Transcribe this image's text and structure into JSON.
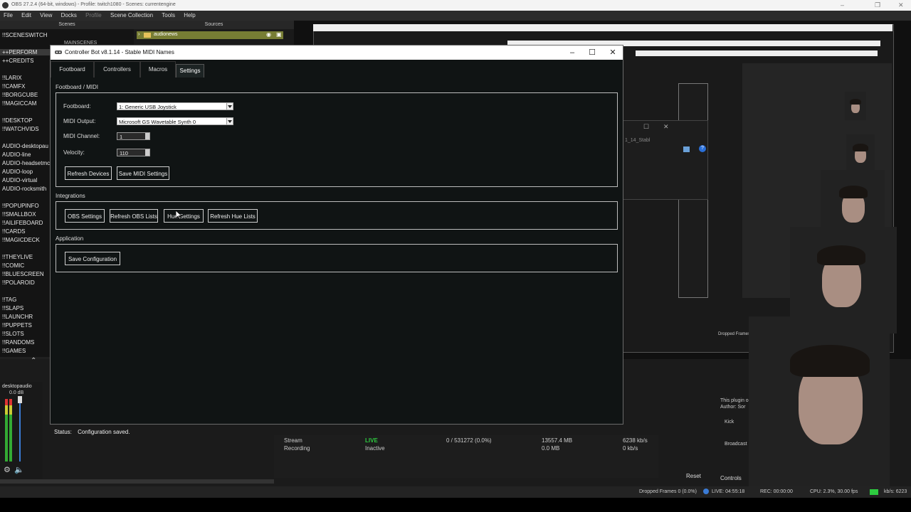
{
  "obs": {
    "title": "OBS 27.2.4 (64-bit, windows) - Profile: twitch1080 - Scenes: currentengine",
    "menu": [
      "File",
      "Edit",
      "View",
      "Docks",
      "Profile",
      "Scene Collection",
      "Tools",
      "Help"
    ],
    "scenes_header": "Scenes",
    "sources_header": "Sources",
    "scenes": [
      "!!SCENESWITCH",
      "++PERFORM",
      "++CREDITS",
      "!!LARIX",
      "!!CAMFX",
      "!!BORGCUBE",
      "!!MAGICCAM",
      "!!DESKTOP",
      "!!WATCHVIDS",
      "AUDIO-desktopau",
      "AUDIO-line",
      "AUDIO-headsetmc",
      "AUDIO-loop",
      "AUDIO-virtual",
      "AUDIO-rocksmith",
      "!!POPUPINFO",
      "!!SMALLBOX",
      "!!AILIFEBOARD",
      "!!CARDS",
      "!!MAGICDECK",
      "!!THEYLIVE",
      "!!COMIC",
      "!!BLUESCREEN",
      "!!POLAROID",
      "!!TAG",
      "!!SLAPS",
      "!!LAUNCHR",
      "!!PUPPETS",
      "!!SLOTS",
      "!!RANDOMS",
      "!!GAMES"
    ],
    "scene_partial": "MAINSCENES",
    "sources": [
      "audionews"
    ],
    "mixer_source": "desktopaudio",
    "mixer_level": "0.0 dB",
    "stats": [
      {
        "label": "Stream",
        "status": "LIVE",
        "dropped": "0 / 531272 (0.0%)",
        "data": "13557.4 MB",
        "bitrate": "6238 kb/s"
      },
      {
        "label": "Recording",
        "status": "Inactive",
        "dropped": "",
        "data": "0.0 MB",
        "bitrate": "0 kb/s"
      }
    ],
    "reset_label": "Reset",
    "controls_label": "Controls",
    "plugin_text": "This plugin o",
    "plugin_author": "Author: Sor",
    "kick_label": "Kick",
    "broadcast_label": "Broadcast",
    "statusbar": {
      "dropped": "Dropped Frames 0 (0.0%)",
      "live": "LIVE: 04:55:18",
      "rec": "REC: 00:00:00",
      "cpu": "CPU: 2.3%, 30.00 fps",
      "kbps": "kb/s: 6223"
    }
  },
  "cb": {
    "title": "Controller Bot v8.1.14 - Stable MIDI Names",
    "window_controls": {
      "minimize": "–",
      "maximize": "☐",
      "close": "✕"
    },
    "tabs": [
      "Footboard",
      "Controllers",
      "Macros",
      "Settings"
    ],
    "active_tab": "Settings",
    "sections": {
      "footboard_midi": "Footboard / MIDI",
      "integrations": "Integrations",
      "application": "Application"
    },
    "fields": {
      "footboard_label": "Footboard:",
      "footboard_value": "1: Generic USB Joystick",
      "midi_output_label": "MIDI Output:",
      "midi_output_value": "Microsoft GS Wavetable Synth 0",
      "midi_channel_label": "MIDI Channel:",
      "midi_channel_value": "1",
      "velocity_label": "Velocity:",
      "velocity_value": "110"
    },
    "buttons": {
      "refresh_devices": "Refresh Devices",
      "save_midi": "Save MIDI Settings",
      "obs_settings": "OBS Settings",
      "refresh_obs_lists": "Refresh OBS Lists",
      "hue_settings": "Hue Settings",
      "refresh_hue_lists": "Refresh Hue Lists",
      "save_configuration": "Save Configuration"
    },
    "status_label": "Status:",
    "status_value": "Configuration saved."
  },
  "colors": {
    "dialog_bg": "#101414",
    "live_green": "#2ecc40",
    "source_highlight": "#777d34"
  }
}
